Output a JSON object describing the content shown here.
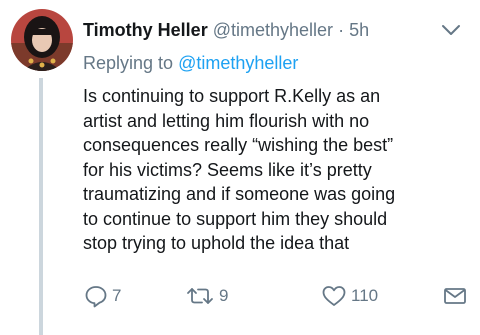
{
  "tweet": {
    "display_name": "Timothy Heller",
    "handle": "@timethyheller",
    "separator": "·",
    "time": "5h",
    "replying_prefix": "Replying to",
    "replying_to": "@timethyheller",
    "body_lines": [
      "Is continuing to support R.Kelly as an",
      "artist and letting him flourish with no",
      "consequences really “wishing the best”",
      "for his victims? Seems like it’s pretty",
      "traumatizing and if someone was going",
      "to continue to support him they should",
      "stop trying to uphold the idea that"
    ],
    "actions": {
      "reply_count": "7",
      "retweet_count": "9",
      "like_count": "110"
    }
  },
  "icons": {
    "caret": "chevron-down-icon",
    "reply": "reply-icon",
    "retweet": "retweet-icon",
    "like": "heart-icon",
    "message": "envelope-icon"
  },
  "colors": {
    "text": "#14171a",
    "secondary": "#657786",
    "link": "#1da1f2",
    "thread_line": "#ccd6dd"
  }
}
